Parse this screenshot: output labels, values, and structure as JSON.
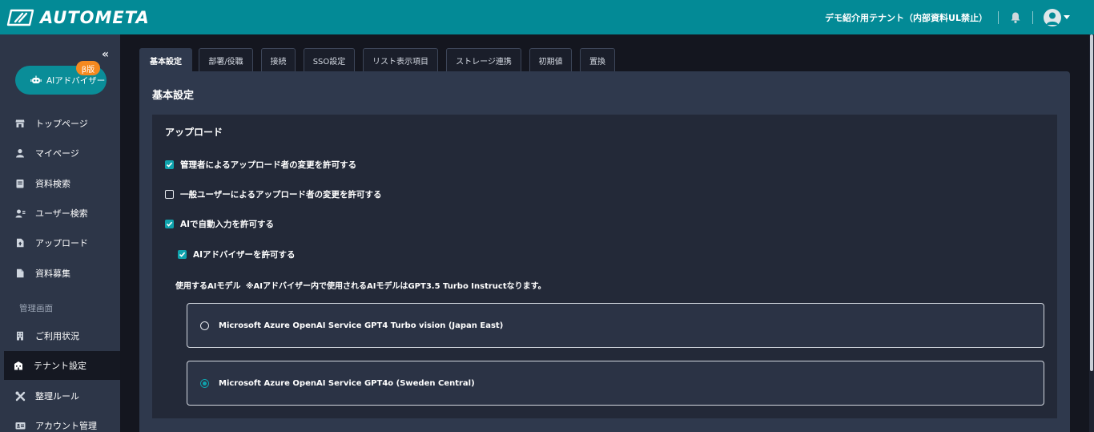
{
  "header": {
    "brand": "AUTOMETA",
    "tenant": "デモ紹介用テナント（内部資料UL禁止）",
    "bg_color": "#038a96"
  },
  "sidebar": {
    "collapse_icon": "«",
    "ai_button": {
      "label": "AIアドバイザー",
      "badge": "β版"
    },
    "items": [
      {
        "label": "トップページ",
        "icon": "store-icon"
      },
      {
        "label": "マイページ",
        "icon": "user-icon"
      },
      {
        "label": "資料検索",
        "icon": "document-search-icon"
      },
      {
        "label": "ユーザー検索",
        "icon": "user-search-icon"
      },
      {
        "label": "アップロード",
        "icon": "upload-icon"
      },
      {
        "label": "資料募集",
        "icon": "file-icon"
      }
    ],
    "admin_section": "管理画面",
    "admin_items": [
      {
        "label": "ご利用状況",
        "icon": "building-icon"
      },
      {
        "label": "テナント設定",
        "icon": "tenant-icon",
        "active": true
      },
      {
        "label": "整理ルール",
        "icon": "tools-icon"
      },
      {
        "label": "アカウント管理",
        "icon": "id-card-icon"
      }
    ]
  },
  "tabs": [
    "基本設定",
    "部署/役職",
    "接続",
    "SSO設定",
    "リスト表示項目",
    "ストレージ連携",
    "初期値",
    "置換"
  ],
  "active_tab": "基本設定",
  "main": {
    "title": "基本設定",
    "section_title": "アップロード",
    "checkboxes": [
      {
        "label": "管理者によるアップロード者の変更を許可する",
        "checked": true
      },
      {
        "label": "一般ユーザーによるアップロード者の変更を許可する",
        "checked": false
      },
      {
        "label": "AIで自動入力を許可する",
        "checked": true
      },
      {
        "label": "AIアドバイザーを許可する",
        "checked": true
      }
    ],
    "model_label": "使用するAIモデル",
    "model_note": "※AIアドバイザー内で使用されるAIモデルはGPT3.5 Turbo Instructなります。",
    "models": [
      {
        "label": "Microsoft Azure OpenAI Service GPT4 Turbo vision (Japan East)",
        "selected": false
      },
      {
        "label": "Microsoft Azure OpenAI Service GPT4o (Sweden Central)",
        "selected": true
      }
    ]
  },
  "colors": {
    "accent": "#0fa3ad",
    "sidebar": "#2d3648",
    "card": "#2f394d",
    "section": "#232938"
  }
}
